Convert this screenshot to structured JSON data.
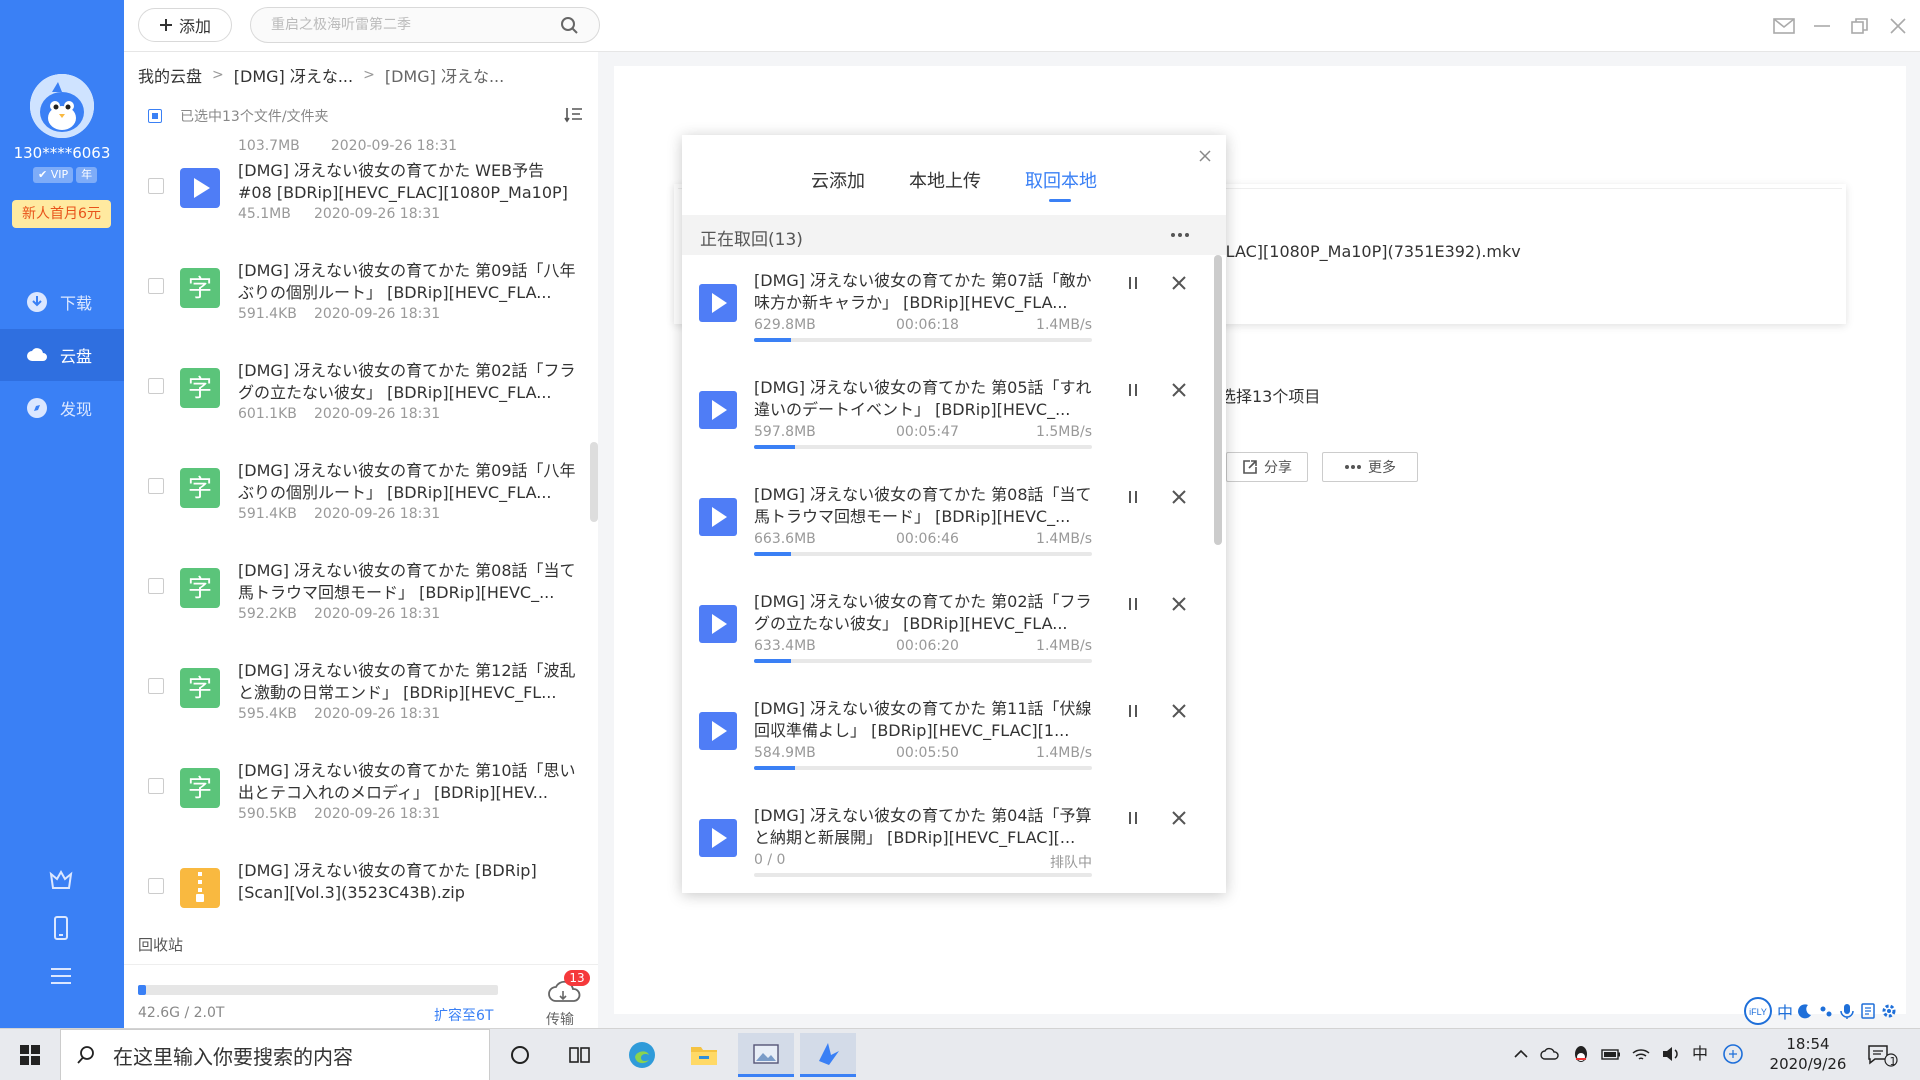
{
  "sidebar": {
    "username": "130****6063",
    "vip_badges": [
      "✔ VIP",
      "年"
    ],
    "promo": "新人首月6元",
    "nav": [
      {
        "label": "下载"
      },
      {
        "label": "云盘"
      },
      {
        "label": "发现"
      }
    ]
  },
  "topbar": {
    "add_label": "添加",
    "search_placeholder": "重启之极海听雷第二季"
  },
  "breadcrumb": [
    "我的云盘",
    "[DMG] 冴えな...",
    "[DMG] 冴えな..."
  ],
  "selection": {
    "text": "已选中13个文件/文件夹"
  },
  "partial_row": {
    "size": "103.7MB",
    "date": "2020-09-26 18:31"
  },
  "files": [
    {
      "type": "video",
      "name": "[DMG] 冴えない彼女の育てかた WEB予告 #08 [BDRip][HEVC_FLAC][1080P_Ma10P](...",
      "size": "45.1MB",
      "date": "2020-09-26 18:31"
    },
    {
      "type": "sub",
      "icon_text": "字",
      "name": "[DMG] 冴えない彼女の育てかた 第09話「八年ぶりの個別ルート」 [BDRip][HEVC_FLA...",
      "size": "591.4KB",
      "date": "2020-09-26 18:31"
    },
    {
      "type": "sub",
      "icon_text": "字",
      "name": "[DMG] 冴えない彼女の育てかた 第02話「フラグの立たない彼女」 [BDRip][HEVC_FLA...",
      "size": "601.1KB",
      "date": "2020-09-26 18:31"
    },
    {
      "type": "sub",
      "icon_text": "字",
      "name": "[DMG] 冴えない彼女の育てかた 第09話「八年ぶりの個別ルート」 [BDRip][HEVC_FLA...",
      "size": "591.4KB",
      "date": "2020-09-26 18:31"
    },
    {
      "type": "sub",
      "icon_text": "字",
      "name": "[DMG] 冴えない彼女の育てかた 第08話「当て馬トラウマ回想モード」 [BDRip][HEVC_...",
      "size": "592.2KB",
      "date": "2020-09-26 18:31"
    },
    {
      "type": "sub",
      "icon_text": "字",
      "name": "[DMG] 冴えない彼女の育てかた 第12話「波乱と激動の日常エンド」 [BDRip][HEVC_FL...",
      "size": "595.4KB",
      "date": "2020-09-26 18:31"
    },
    {
      "type": "sub",
      "icon_text": "字",
      "name": "[DMG] 冴えない彼女の育てかた 第10話「思い出とテコ入れのメロディ」 [BDRip][HEV...",
      "size": "590.5KB",
      "date": "2020-09-26 18:31"
    },
    {
      "type": "zip",
      "name": "[DMG] 冴えない彼女の育てかた [BDRip][Scan][Vol.3](3523C43B).zip",
      "size": "",
      "date": ""
    }
  ],
  "recycle_label": "回收站",
  "storage": {
    "text": "42.6G / 2.0T",
    "used_fraction": 0.021,
    "expand_label": "扩容至6T",
    "transfer_label": "传输",
    "transfer_badge": "13"
  },
  "detail": {
    "card_filename": "Rip][HEVC_FLAC][1080P_Ma10P](7351E392).mkv",
    "selected_text": "选择13个项目",
    "share_label": "分享",
    "more_label": "更多"
  },
  "popup": {
    "tabs": [
      "云添加",
      "本地上传",
      "取回本地"
    ],
    "active_tab": 2,
    "section_title": "正在取回(13)",
    "items": [
      {
        "name": "[DMG] 冴えない彼女の育てかた 第07話「敵か味方か新キャラか」 [BDRip][HEVC_FLA...",
        "size": "629.8MB",
        "time": "00:06:18",
        "speed": "1.4MB/s",
        "progress": 0.11
      },
      {
        "name": "[DMG] 冴えない彼女の育てかた 第05話「すれ違いのデートイベント」 [BDRip][HEVC_...",
        "size": "597.8MB",
        "time": "00:05:47",
        "speed": "1.5MB/s",
        "progress": 0.12
      },
      {
        "name": "[DMG] 冴えない彼女の育てかた 第08話「当て馬トラウマ回想モード」 [BDRip][HEVC_...",
        "size": "663.6MB",
        "time": "00:06:46",
        "speed": "1.4MB/s",
        "progress": 0.11
      },
      {
        "name": "[DMG] 冴えない彼女の育てかた 第02話「フラグの立たない彼女」 [BDRip][HEVC_FLA...",
        "size": "633.4MB",
        "time": "00:06:20",
        "speed": "1.4MB/s",
        "progress": 0.11
      },
      {
        "name": "[DMG] 冴えない彼女の育てかた 第11話「伏線回収準備よし」 [BDRip][HEVC_FLAC][1...",
        "size": "584.9MB",
        "time": "00:05:50",
        "speed": "1.4MB/s",
        "progress": 0.12
      },
      {
        "name": "[DMG] 冴えない彼女の育てかた 第04話「予算と納期と新展開」 [BDRip][HEVC_FLAC][...",
        "size": "0 / 0",
        "time": "",
        "speed": "排队中",
        "progress": 0
      }
    ]
  },
  "taskbar": {
    "search_placeholder": "在这里输入你要搜索的内容",
    "time": "18:54",
    "date": "2020/9/26",
    "notif_count": "1"
  },
  "ime": {
    "mode": "中"
  },
  "colors": {
    "accent": "#3a80f5",
    "sidebar": "#3a80f5",
    "subtitle_icon": "#5bc47a",
    "video_icon": "#4f7df6",
    "zip_icon": "#f9b940",
    "badge": "#f5393b"
  }
}
